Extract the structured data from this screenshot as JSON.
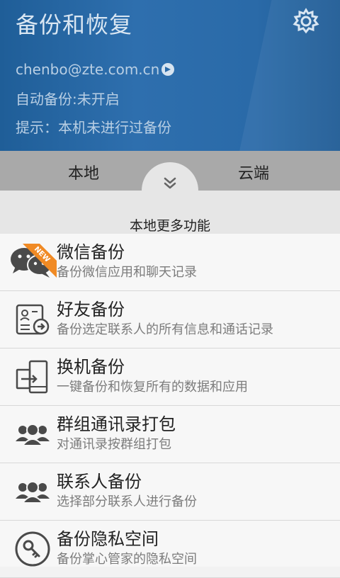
{
  "header": {
    "title": "备份和恢复",
    "email": "chenbo@zte.com.cn",
    "auto_backup": "自动备份:未开启",
    "hint": "提示：本机未进行过备份"
  },
  "tabs": {
    "local": "本地",
    "cloud": "云端"
  },
  "more_label": "本地更多功能",
  "badge": "NEW",
  "items": [
    {
      "title": "微信备份",
      "subtitle": "备份微信应用和聊天记录",
      "icon": "wechat-icon"
    },
    {
      "title": "好友备份",
      "subtitle": "备份选定联系人的所有信息和通话记录",
      "icon": "contact-card-icon"
    },
    {
      "title": "换机备份",
      "subtitle": "一键备份和恢复所有的数据和应用",
      "icon": "phone-transfer-icon"
    },
    {
      "title": "群组通讯录打包",
      "subtitle": "对通讯录按群组打包",
      "icon": "group-icon"
    },
    {
      "title": "联系人备份",
      "subtitle": "选择部分联系人进行备份",
      "icon": "contacts-icon"
    },
    {
      "title": "备份隐私空间",
      "subtitle": "备份掌心管家的隐私空间",
      "icon": "key-icon"
    }
  ],
  "colors": {
    "header": "#2a6aa8",
    "tab_bar": "#a9a9a9",
    "badge": "#f08a24"
  }
}
